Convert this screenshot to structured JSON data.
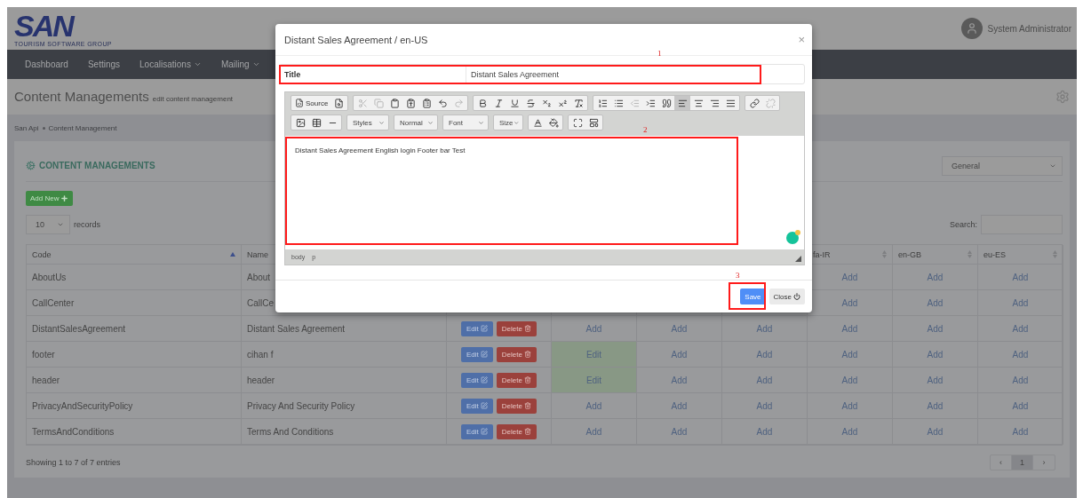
{
  "header": {
    "logo": {
      "name": "SAN",
      "tagline": "TOURISM SOFTWARE GROUP"
    },
    "user": "System Administrator"
  },
  "nav": [
    {
      "label": "Dashboard",
      "dropdown": false
    },
    {
      "label": "Settings",
      "dropdown": false
    },
    {
      "label": "Localisations",
      "dropdown": true
    },
    {
      "label": "Mailing",
      "dropdown": true
    }
  ],
  "page": {
    "title": "Content Managements",
    "subtitle": "edit content management",
    "breadcrumb": [
      "San Api",
      "Content Management"
    ]
  },
  "card": {
    "title": "CONTENT MANAGEMENTS",
    "category": "General",
    "add_button": "Add New",
    "page_size": "10",
    "page_size_label": "records",
    "search_label": "Search:",
    "info": "Showing 1 to 7 of 7 entries",
    "pagination": {
      "prev": "‹",
      "pages": [
        {
          "label": "1",
          "selected": true
        }
      ],
      "next": "›"
    }
  },
  "table": {
    "columns": [
      {
        "label": "Code",
        "sorted": true
      },
      {
        "label": "Name"
      },
      null,
      null,
      null,
      null,
      {
        "label": "fa-IR",
        "sorted": false
      },
      {
        "label": "en-GB",
        "sorted": false
      },
      {
        "label": "eu-ES",
        "sorted": false
      }
    ],
    "rows": [
      {
        "code": "AboutUs",
        "name": "About",
        "cells": [
          null,
          null,
          null,
          null,
          {
            "label": "Add",
            "exists": false
          },
          {
            "label": "Add",
            "exists": false
          },
          {
            "label": "Add",
            "exists": false
          }
        ]
      },
      {
        "code": "CallCenter",
        "name": "CallCe",
        "cells": [
          null,
          null,
          null,
          null,
          {
            "label": "Add",
            "exists": false
          },
          {
            "label": "Add",
            "exists": false
          },
          {
            "label": "Add",
            "exists": false
          }
        ]
      },
      {
        "code": "DistantSalesAgreement",
        "name": "Distant Sales Agreement",
        "actions": [
          {
            "kind": "edit",
            "label": "Edit"
          },
          {
            "kind": "delete",
            "label": "Delete"
          }
        ],
        "cells": [
          {
            "label": "Add",
            "exists": false
          },
          {
            "label": "Add",
            "exists": false
          },
          {
            "label": "Add",
            "exists": false
          },
          {
            "label": "Add",
            "exists": false
          },
          {
            "label": "Add",
            "exists": false
          },
          {
            "label": "Add",
            "exists": false
          }
        ]
      },
      {
        "code": "footer",
        "name": "cihan f",
        "actions": [
          {
            "kind": "edit",
            "label": "Edit"
          },
          {
            "kind": "delete",
            "label": "Delete"
          }
        ],
        "cells": [
          {
            "label": "Edit",
            "exists": true
          },
          {
            "label": "Add",
            "exists": false
          },
          {
            "label": "Add",
            "exists": false
          },
          {
            "label": "Add",
            "exists": false
          },
          {
            "label": "Add",
            "exists": false
          },
          {
            "label": "Add",
            "exists": false
          }
        ]
      },
      {
        "code": "header",
        "name": "header",
        "actions": [
          {
            "kind": "edit",
            "label": "Edit"
          },
          {
            "kind": "delete",
            "label": "Delete"
          }
        ],
        "cells": [
          {
            "label": "Edit",
            "exists": true
          },
          {
            "label": "Add",
            "exists": false
          },
          {
            "label": "Add",
            "exists": false
          },
          {
            "label": "Add",
            "exists": false
          },
          {
            "label": "Add",
            "exists": false
          },
          {
            "label": "Add",
            "exists": false
          }
        ]
      },
      {
        "code": "PrivacyAndSecurityPolicy",
        "name": "Privacy And Security Policy",
        "actions": [
          {
            "kind": "edit",
            "label": "Edit"
          },
          {
            "kind": "delete",
            "label": "Delete"
          }
        ],
        "cells": [
          {
            "label": "Add",
            "exists": false
          },
          {
            "label": "Add",
            "exists": false
          },
          {
            "label": "Add",
            "exists": false
          },
          {
            "label": "Add",
            "exists": false
          },
          {
            "label": "Add",
            "exists": false
          },
          {
            "label": "Add",
            "exists": false
          }
        ]
      },
      {
        "code": "TermsAndConditions",
        "name": "Terms And Conditions",
        "actions": [
          {
            "kind": "edit",
            "label": "Edit"
          },
          {
            "kind": "delete",
            "label": "Delete"
          }
        ],
        "cells": [
          {
            "label": "Add",
            "exists": false
          },
          {
            "label": "Add",
            "exists": false
          },
          {
            "label": "Add",
            "exists": false
          },
          {
            "label": "Add",
            "exists": false
          },
          {
            "label": "Add",
            "exists": false
          },
          {
            "label": "Add",
            "exists": false
          }
        ]
      }
    ]
  },
  "modal": {
    "title": "Distant Sales Agreement / en-US",
    "close": "×",
    "fields": [
      {
        "label": "Title",
        "value": "Distant Sales Agreement"
      }
    ],
    "editor": {
      "source_label": "Source",
      "align_buttons": [
        {
          "kind": "left",
          "selected": true
        },
        {
          "kind": "center",
          "selected": false
        },
        {
          "kind": "right",
          "selected": false
        },
        {
          "kind": "justify",
          "selected": false
        }
      ],
      "combos": [
        "Styles",
        "Normal",
        "Font",
        "Size"
      ],
      "content": "Distant Sales Agreement English login Footer bar Test",
      "path": [
        "body",
        "p"
      ]
    },
    "buttons": [
      {
        "kind": "primary",
        "label": "Save"
      },
      {
        "kind": "close",
        "label": "Close"
      }
    ],
    "annotations": [
      "1",
      "2",
      "3"
    ]
  }
}
